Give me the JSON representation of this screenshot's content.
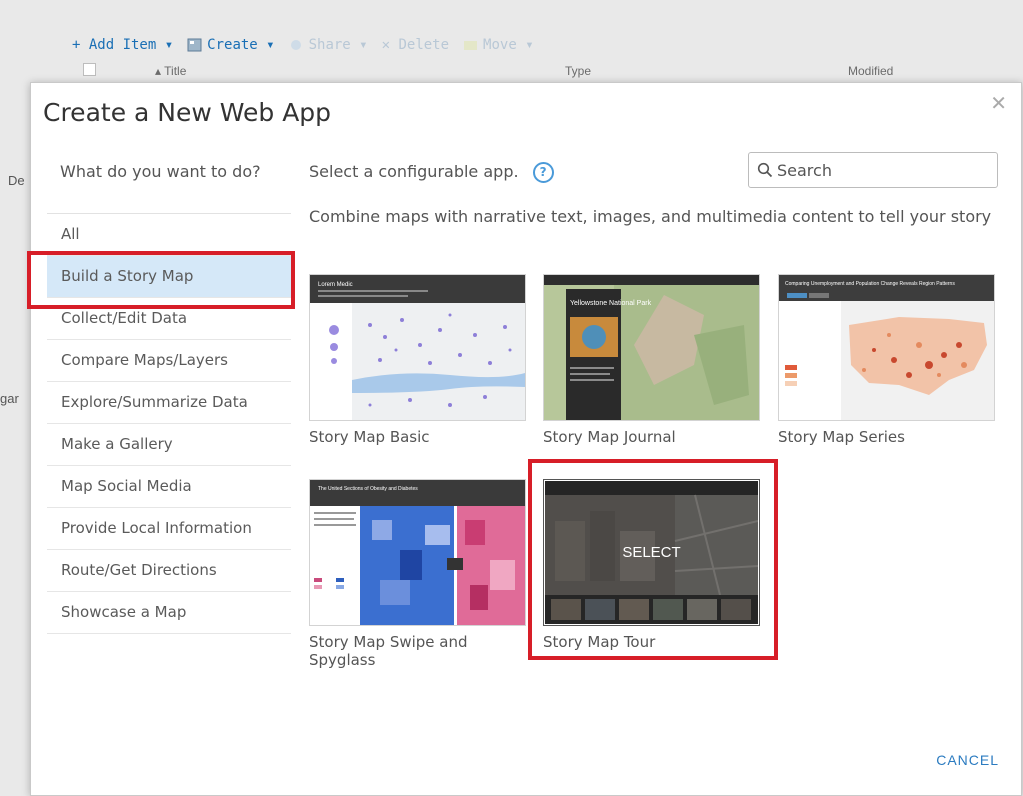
{
  "background": {
    "toolbar": [
      {
        "label": "+ Add Item ▾",
        "state": "active"
      },
      {
        "label": "Create ▾",
        "state": "active"
      },
      {
        "label": "Share ▾",
        "state": "disabled"
      },
      {
        "label": "✕ Delete",
        "state": "disabled"
      },
      {
        "label": "Move ▾",
        "state": "disabled"
      }
    ],
    "columns": {
      "title": "▴ Title",
      "type": "Type",
      "modified": "Modified"
    },
    "side_fragments": [
      "De",
      "gar"
    ]
  },
  "modal": {
    "title": "Create a New Web App",
    "close_icon": "✕",
    "question": "What do you want to do?",
    "nav_items": [
      "All",
      "Build a Story Map",
      "Collect/Edit Data",
      "Compare Maps/Layers",
      "Explore/Summarize Data",
      "Make a Gallery",
      "Map Social Media",
      "Provide Local Information",
      "Route/Get Directions",
      "Showcase a Map"
    ],
    "active_nav_index": 1,
    "select_label": "Select a configurable app.",
    "help_icon": "?",
    "search_placeholder": "Search",
    "description": "Combine maps with narrative text, images, and multimedia content to tell your story",
    "apps": [
      {
        "label": "Story Map Basic",
        "thumb_title": "Lorem Medic"
      },
      {
        "label": "Story Map Journal",
        "thumb_title": "Yellowstone National Park"
      },
      {
        "label": "Story Map Series",
        "thumb_title": "Comparing Unemployment and Population Change Reveals Region Patterns"
      },
      {
        "label": "Story Map Swipe and Spyglass",
        "thumb_title": "The United Sections of Obesity and Diabetes"
      },
      {
        "label": "Story Map Tour",
        "overlay": "SELECT"
      }
    ],
    "cancel_label": "CANCEL"
  },
  "colors": {
    "accent": "#2b7bc0",
    "highlight": "#d71e28",
    "active_nav": "#d5e8f8"
  }
}
